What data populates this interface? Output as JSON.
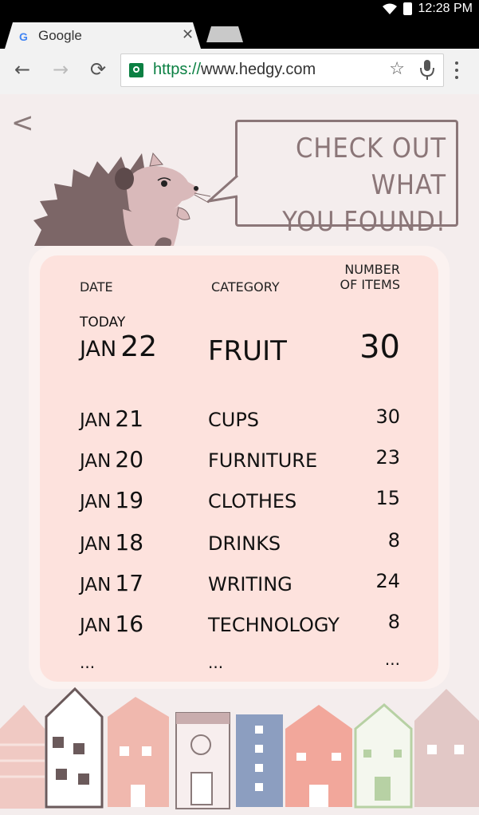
{
  "status_bar": {
    "time": "12:28 PM"
  },
  "browser": {
    "tab_title": "Google",
    "tab_favicon": "G",
    "url_scheme": "https://",
    "url_host": "www.hedgy.com",
    "icons": [
      "back-arrow-icon",
      "forward-arrow-icon",
      "reload-icon",
      "lock-icon",
      "star-icon",
      "mic-icon",
      "menu-icon",
      "close-icon"
    ]
  },
  "hero": {
    "bubble_line1": "CHECK OUT WHAT",
    "bubble_line2": "YOU FOUND!",
    "back_glyph": "<"
  },
  "table": {
    "headers": {
      "date": "DATE",
      "category": "CATEGORY",
      "items_line1": "NUMBER",
      "items_line2": "OF ITEMS"
    },
    "today": {
      "label": "TODAY",
      "month": "JAN",
      "day": "22",
      "category": "FRUIT",
      "count": "30"
    },
    "rows": [
      {
        "month": "JAN",
        "day": "21",
        "category": "CUPS",
        "count": "30"
      },
      {
        "month": "JAN",
        "day": "20",
        "category": "FURNITURE",
        "count": "23"
      },
      {
        "month": "JAN",
        "day": "19",
        "category": "CLOTHES",
        "count": "15"
      },
      {
        "month": "JAN",
        "day": "18",
        "category": "DRINKS",
        "count": "8"
      },
      {
        "month": "JAN",
        "day": "17",
        "category": "WRITING",
        "count": "24"
      },
      {
        "month": "JAN",
        "day": "16",
        "category": "TECHNOLOGY",
        "count": "8"
      }
    ],
    "ellipsis": "..."
  },
  "colors": {
    "card": "#fde2dd",
    "accent": "#8b7678",
    "https_green": "#0b8043"
  }
}
